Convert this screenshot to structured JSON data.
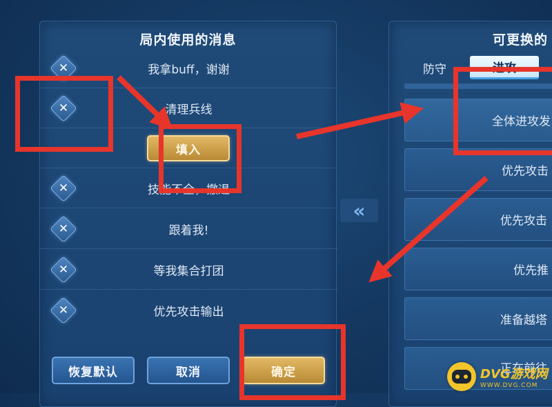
{
  "left_panel": {
    "title": "局内使用的消息",
    "messages": [
      {
        "text": "我拿buff，谢谢"
      },
      {
        "text": "清理兵线"
      },
      {
        "text": "技能不全，撤退"
      },
      {
        "text": "跟着我!"
      },
      {
        "text": "等我集合打团"
      },
      {
        "text": "优先攻击输出"
      }
    ],
    "fill_button": "填入",
    "buttons": {
      "reset": "恢复默认",
      "cancel": "取消",
      "confirm": "确定"
    }
  },
  "right_panel": {
    "title": "可更换的",
    "tabs": [
      {
        "label": "防守",
        "active": false
      },
      {
        "label": "进攻",
        "active": true
      }
    ],
    "options": [
      {
        "text": "全体进攻发"
      },
      {
        "text": "优先攻击"
      },
      {
        "text": "优先攻击"
      },
      {
        "text": "优先推"
      },
      {
        "text": "准备越塔"
      },
      {
        "text": "正在前往"
      }
    ]
  },
  "transfer_icon": "double-chevron-left-icon",
  "annotation_color": "#e8352b",
  "accent_gold": "#d4a84e",
  "watermark": {
    "main": "DVG游戏网",
    "sub": "WWW.DVG.COM"
  }
}
